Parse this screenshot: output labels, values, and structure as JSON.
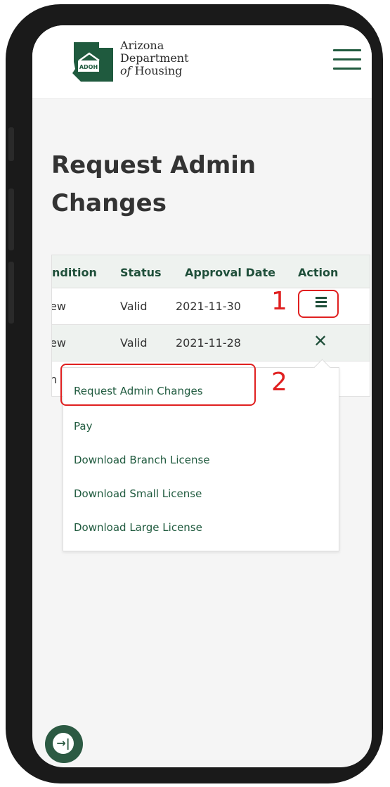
{
  "header": {
    "logo_line1": "Arizona",
    "logo_line2": "Department",
    "logo_line3_prefix": "of",
    "logo_line3": "Housing",
    "logo_badge": "ADOH"
  },
  "page_title": "Request Admin Changes",
  "table": {
    "columns": [
      "ndition",
      "Status",
      "Approval Date",
      "Action"
    ],
    "rows": [
      {
        "condition": "ew",
        "status": "Valid",
        "approval_date": "2021-11-30"
      },
      {
        "condition": "ew",
        "status": "Valid",
        "approval_date": "2021-11-28"
      },
      {
        "condition": "n",
        "status": "",
        "approval_date": ""
      }
    ]
  },
  "dropdown": {
    "items": [
      "Request Admin Changes",
      "Pay",
      "Download Branch License",
      "Download Small License",
      "Download Large License"
    ]
  },
  "annotations": {
    "step1": "1",
    "step2": "2"
  },
  "icons": {
    "fab": "sign-in-arrow-icon",
    "action_open": "hamburger-menu-icon",
    "action_close": "close-icon"
  },
  "colors": {
    "brand_green": "#1f5a3e",
    "annotation_red": "#e02020"
  }
}
